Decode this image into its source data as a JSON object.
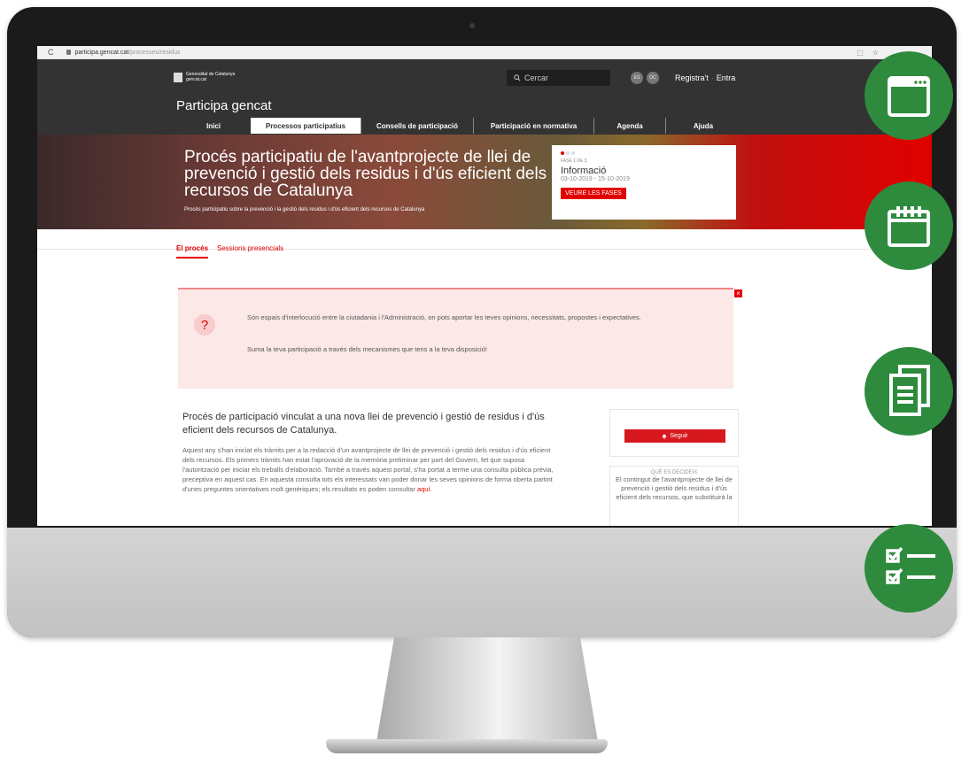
{
  "browser": {
    "url_domain": "participa.gencat.cat",
    "url_path": "/processes/residus"
  },
  "header": {
    "logo_line1": "Generalitat de Catalunya",
    "logo_line2": "gencat.cat",
    "search_placeholder": "Cercar",
    "lang_es": "ES",
    "lang_oc": "OC",
    "register": "Registra't",
    "login": "Entra",
    "site_name": "Participa gencat"
  },
  "nav": [
    {
      "label": "Inici"
    },
    {
      "label": "Processos participatius",
      "active": true
    },
    {
      "label": "Consells de participació"
    },
    {
      "label": "Participació en normativa"
    },
    {
      "label": "Agenda"
    },
    {
      "label": "Ajuda"
    }
  ],
  "hero": {
    "title": "Procés participatiu de l'avantprojecte de llei de prevenció i gestió dels residus i d'ús eficient dels recursos de Catalunya",
    "subtitle": "Procés participatiu sobre la prevenció i la gestió dels residus i d'ús eficient dels recursos de Catalunya"
  },
  "phase": {
    "label": "FASE 1 DE 3",
    "title": "Informació",
    "dates": "03-10-2019 - 15-10-2019",
    "button": "VEURE LES FASES"
  },
  "subtabs": [
    "El procés",
    "Sessions presencials"
  ],
  "notice": {
    "icon": "?",
    "close": "×",
    "text1": "Són espais d'interlocució entre la ciutadania i l'Administració, on pots aportar les teves opinions, necessitats, propostes i expectatives.",
    "text2": "Suma la teva participació a través dels mecanismes que tens a la teva disposició!"
  },
  "content": {
    "title": "Procés de participació vinculat a una nova llei de prevenció i gestió de residus i d'ús eficient dels recursos de Catalunya.",
    "body": "Aquest any s'han iniciat els tràmits per a la redacció d'un avantprojecte de llei de prevenció i gestió dels residus i d'ús eficient dels recursos. Els primers tràmits han estat l'aprovació de la memòria preliminar per part del Govern, fet que suposa l'autorització per iniciar els treballs d'elaboració. També a través aquest portal, s'ha portat a terme una consulta pública prèvia, preceptiva en aquest cas. En aquesta consulta tots els interessats van poder donar les seves opinions de forma oberta partint d'unes preguntes orientatives molt genèriques; els resultats es poden consultar",
    "link": "aquí."
  },
  "sidebar": {
    "follow_button": "Seguir",
    "decide_label": "QUÈ ES DECIDEIX",
    "decide_text": "El contingut de l'avantprojecte de llei de prevenció i gestió dels residus i d'ús eficient dels recursos, que substituirà la"
  },
  "feature_icons": [
    "browser-window-icon",
    "calendar-icon",
    "documents-icon",
    "checklist-icon"
  ],
  "colors": {
    "accent": "#e10000",
    "header_bg": "#333333",
    "feature_green": "#2e8b3e",
    "notice_bg": "#fde8e8"
  }
}
